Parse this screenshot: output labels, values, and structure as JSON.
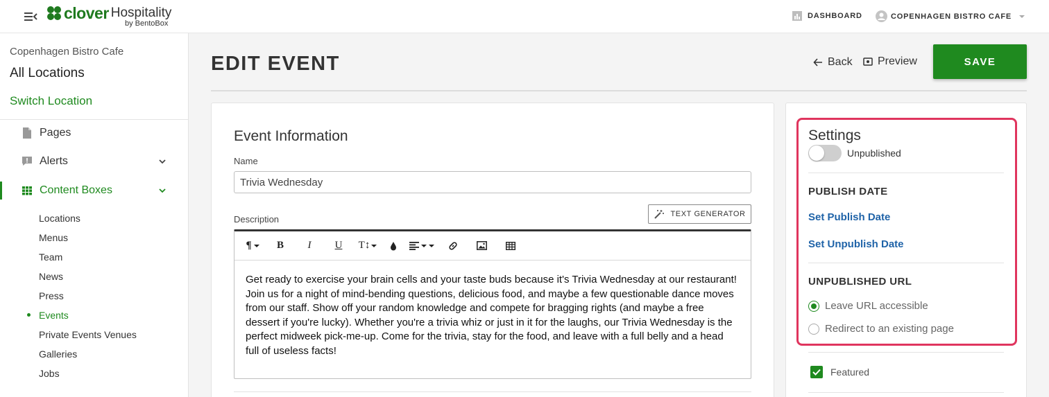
{
  "topbar": {
    "logo_name": "clover",
    "logo_product": "Hospitality",
    "logo_by": "by BentoBox",
    "dashboard_label": "DASHBOARD",
    "account_label": "COPENHAGEN BISTRO CAFE"
  },
  "sidebar": {
    "org_name": "Copenhagen Bistro Cafe",
    "all_locations": "All Locations",
    "switch_location": "Switch Location",
    "items": [
      {
        "label": "Pages",
        "icon": "page-icon"
      },
      {
        "label": "Alerts",
        "icon": "alert-icon"
      },
      {
        "label": "Content Boxes",
        "icon": "grid-icon"
      }
    ],
    "sub_items": [
      "Locations",
      "Menus",
      "Team",
      "News",
      "Press",
      "Events",
      "Private Events Venues",
      "Galleries",
      "Jobs"
    ],
    "active_sub": "Events"
  },
  "header": {
    "title": "EDIT EVENT",
    "back_label": "Back",
    "preview_label": "Preview",
    "save_label": "SAVE"
  },
  "event_info": {
    "section_title": "Event Information",
    "name_label": "Name",
    "name_value": "Trivia Wednesday",
    "description_label": "Description",
    "text_generator_label": "TEXT GENERATOR",
    "description_text": "Get ready to exercise your brain cells and your taste buds because it's Trivia Wednesday at our restaurant! Join us for a night of mind-bending questions, delicious food, and maybe a few questionable dance moves from our staff. Show off your random knowledge and compete for bragging rights (and maybe a free dessert if you're lucky). Whether you're a trivia whiz or just in it for the laughs, our Trivia Wednesday is the perfect midweek pick-me-up. Come for the trivia, stay for the food, and leave with a full belly and a head full of useless facts!"
  },
  "settings": {
    "title": "Settings",
    "publish_toggle_label": "Unpublished",
    "publish_toggle_on": false,
    "publish_date_heading": "PUBLISH DATE",
    "set_publish_date": "Set Publish Date",
    "set_unpublish_date": "Set Unpublish Date",
    "unpublished_url_heading": "UNPUBLISHED URL",
    "radio_options": [
      "Leave URL accessible",
      "Redirect to an existing page"
    ],
    "radio_selected": "Leave URL accessible",
    "featured_label": "Featured",
    "featured_checked": true
  },
  "colors": {
    "brand_green": "#1f8a1f",
    "link_blue": "#1f63a8",
    "highlight_pink": "#e0355e"
  }
}
